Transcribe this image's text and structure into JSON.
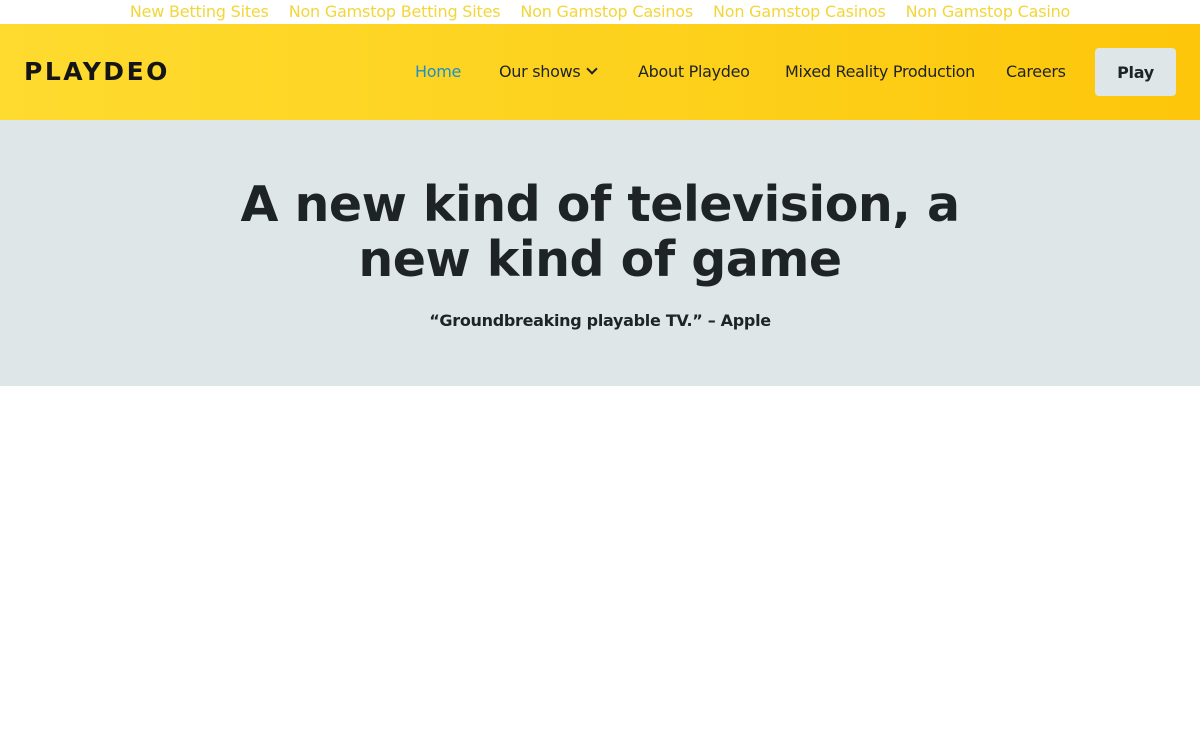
{
  "top_links": [
    "New Betting Sites",
    "Non Gamstop Betting Sites",
    "Non Gamstop Casinos",
    "Non Gamstop Casinos",
    "Non Gamstop Casino"
  ],
  "header": {
    "logo": "PLAYDEO",
    "nav": {
      "home": "Home",
      "our_shows": "Our shows",
      "about": "About Playdeo",
      "mixed_reality": "Mixed Reality Production",
      "careers": "Careers"
    },
    "play_label": "Play"
  },
  "hero": {
    "title": "A new kind of television, a new kind of game",
    "quote": "“Groundbreaking playable TV.” – Apple"
  },
  "colors": {
    "link_yellow": "#f2d63a",
    "header_yellow": "#fdd11c",
    "active_blue": "#1f8fc6",
    "hero_bg": "#dfe6e8",
    "text_dark": "#1e2326"
  },
  "icons": {
    "our_shows_dropdown": "chevron-down-icon"
  }
}
